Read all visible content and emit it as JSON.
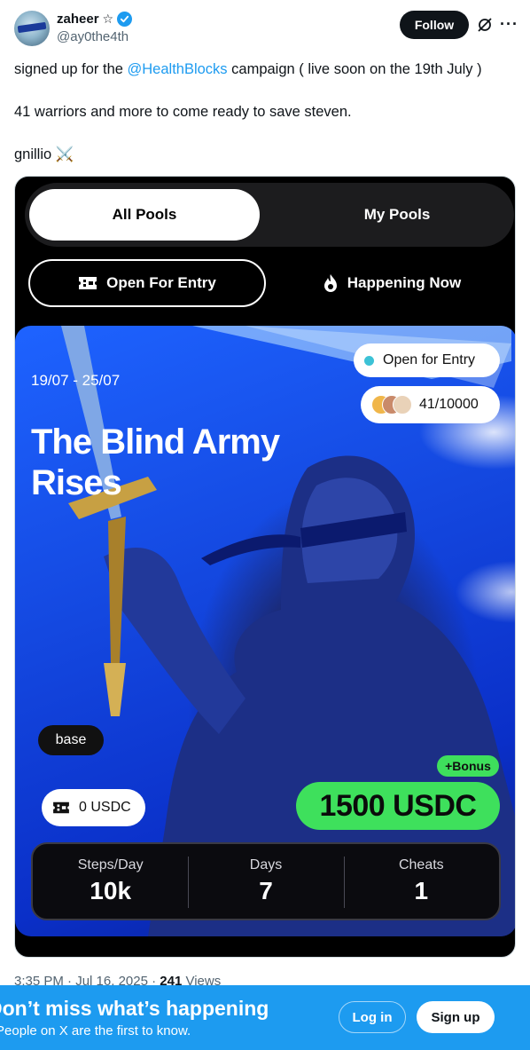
{
  "author": {
    "name": "zaheer",
    "name_symbol": "☆",
    "handle": "@ay0the4th"
  },
  "header": {
    "follow_label": "Follow",
    "icons": [
      "grok-icon",
      "more-icon"
    ]
  },
  "tweet": {
    "line1_prefix": "signed up for the ",
    "line1_mention": "@HealthBlocks",
    "line1_suffix": " campaign ( live soon on the 19th July )",
    "line2": "41 warriors and more to come ready to save steven.",
    "line3": "gnillio",
    "line3_emoji": "⚔️"
  },
  "app": {
    "tabs": [
      {
        "label": "All Pools",
        "selected": true
      },
      {
        "label": "My Pools",
        "selected": false
      }
    ],
    "filters": [
      {
        "label": "Open For Entry",
        "icon": "ticket-icon",
        "selected": true
      },
      {
        "label": "Happening Now",
        "icon": "fire-icon",
        "selected": false
      }
    ],
    "pool": {
      "date_range": "19/07 - 25/07",
      "title": "The Blind Army Rises",
      "status": "Open for Entry",
      "status_color": "#3cc2d6",
      "participants": "41/10000",
      "network": "base",
      "balance": "0 USDC",
      "bonus": "+Bonus",
      "prize": "1500 USDC",
      "accent_color": "#3ee05c",
      "stats": [
        {
          "label": "Steps/Day",
          "value": "10k"
        },
        {
          "label": "Days",
          "value": "7"
        },
        {
          "label": "Cheats",
          "value": "1"
        }
      ]
    }
  },
  "meta": {
    "time": "3:35 PM",
    "separator": " · ",
    "date": "Jul 16, 2025",
    "views_count": "241",
    "views_label": " Views"
  },
  "banner": {
    "title": "Don’t miss what’s happening",
    "subtitle": "People on X are the first to know.",
    "login_label": "Log in",
    "signup_label": "Sign up",
    "color": "#1d9bf0"
  }
}
